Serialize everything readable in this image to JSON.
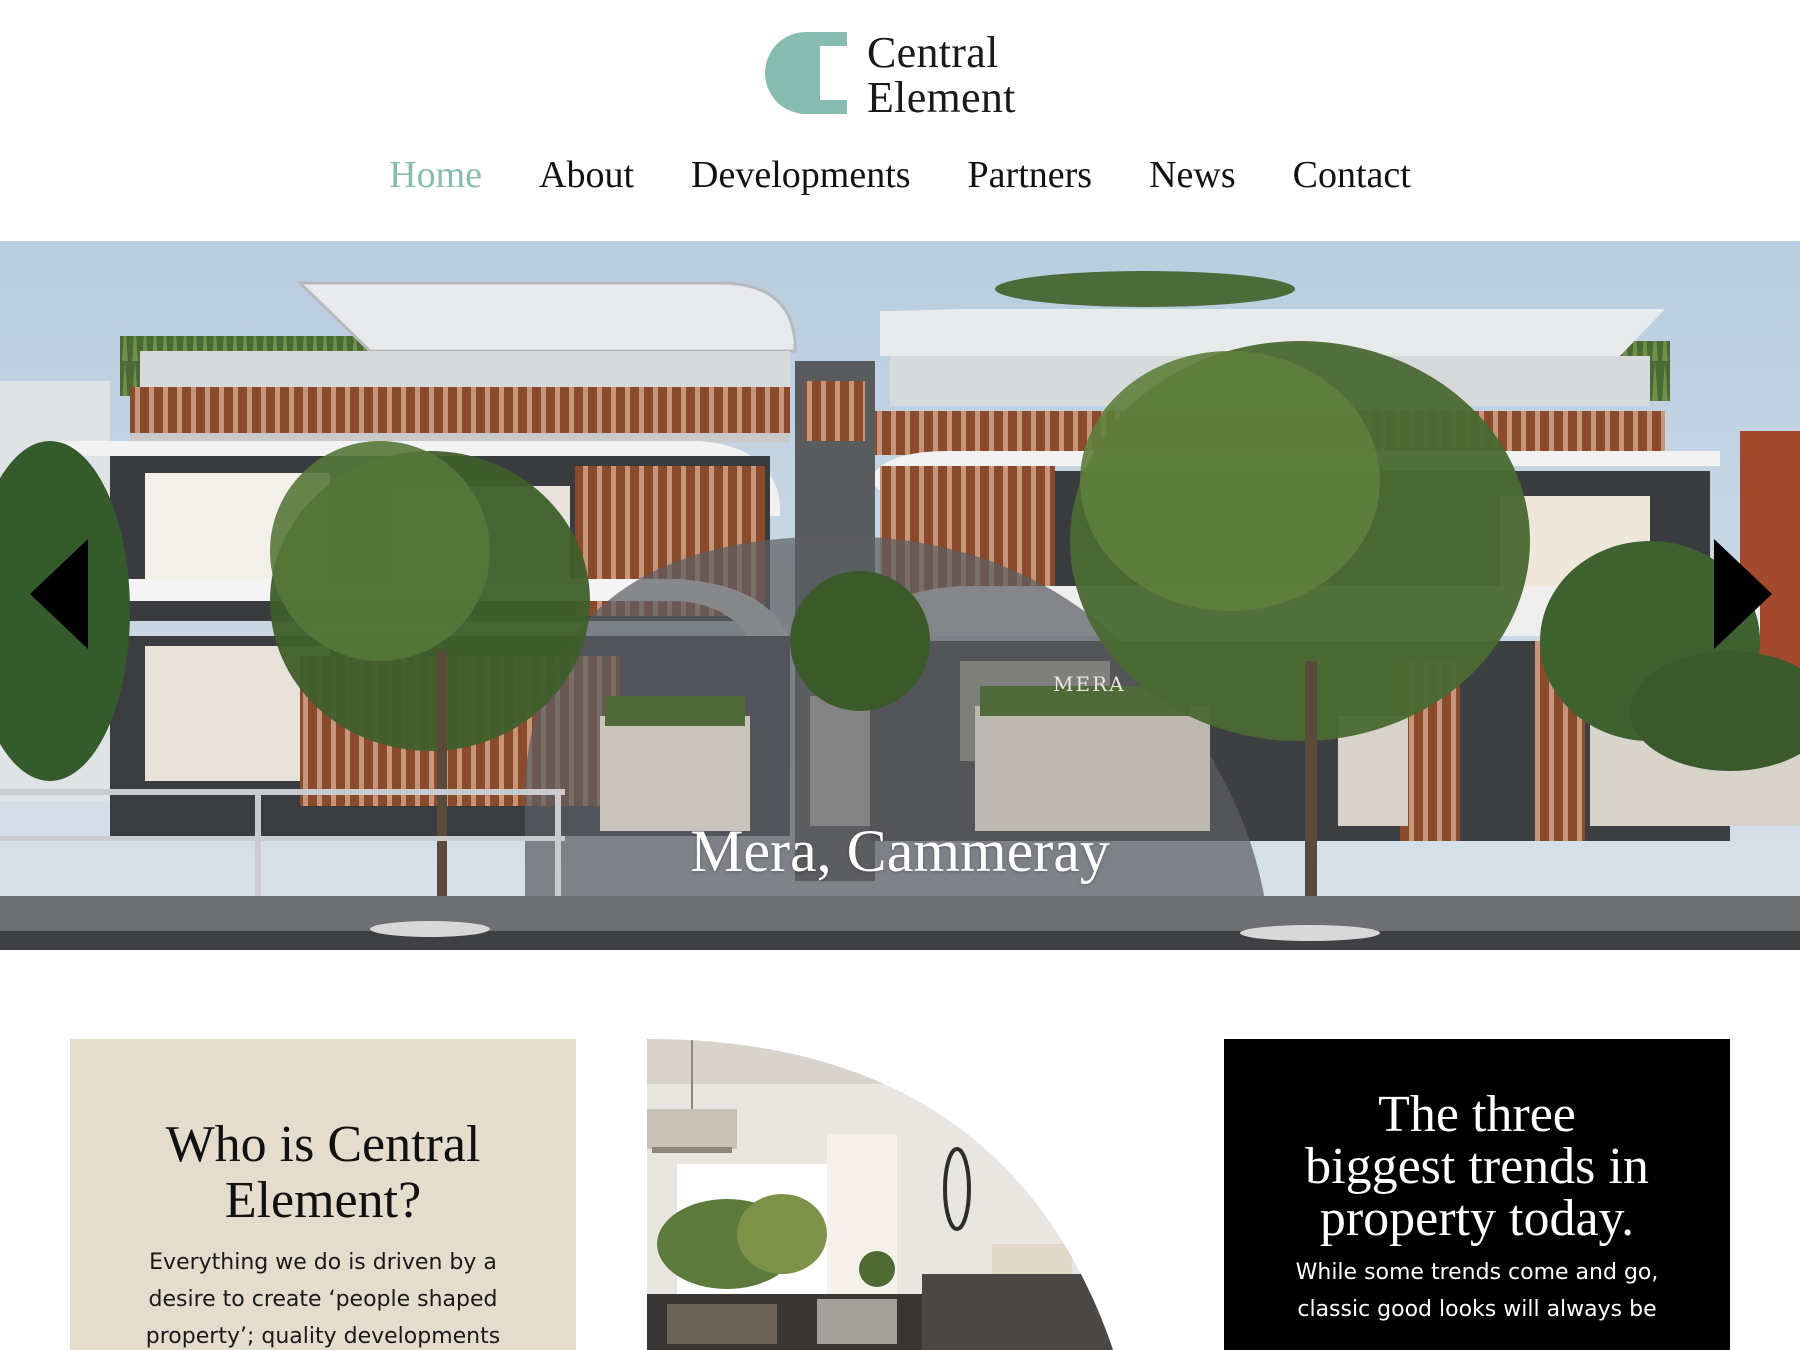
{
  "brand": {
    "name_line1": "Central",
    "name_line2": "Element",
    "accent_color": "#86bdb0",
    "icon": "central-element-logo-icon"
  },
  "nav": {
    "items": [
      {
        "label": "Home",
        "active": true
      },
      {
        "label": "About",
        "active": false
      },
      {
        "label": "Developments",
        "active": false
      },
      {
        "label": "Partners",
        "active": false
      },
      {
        "label": "News",
        "active": false
      },
      {
        "label": "Contact",
        "active": false
      }
    ]
  },
  "hero": {
    "caption": "Mera, Cammeray",
    "signage_text": "MERA",
    "prev_icon": "chevron-left-icon",
    "next_icon": "chevron-right-icon"
  },
  "cards": {
    "about": {
      "title_line1": "Who is Central",
      "title_line2": "Element?",
      "body_lines": [
        "Everything we do is driven by a",
        "desire to create ‘people shaped",
        "property’; quality developments"
      ],
      "background": "#e4dccd"
    },
    "news": {
      "title_lines": [
        "The three",
        "biggest trends in",
        "property today."
      ],
      "body_lines": [
        "While some trends come and go,",
        "classic good looks will always be"
      ],
      "background": "#000000"
    }
  }
}
